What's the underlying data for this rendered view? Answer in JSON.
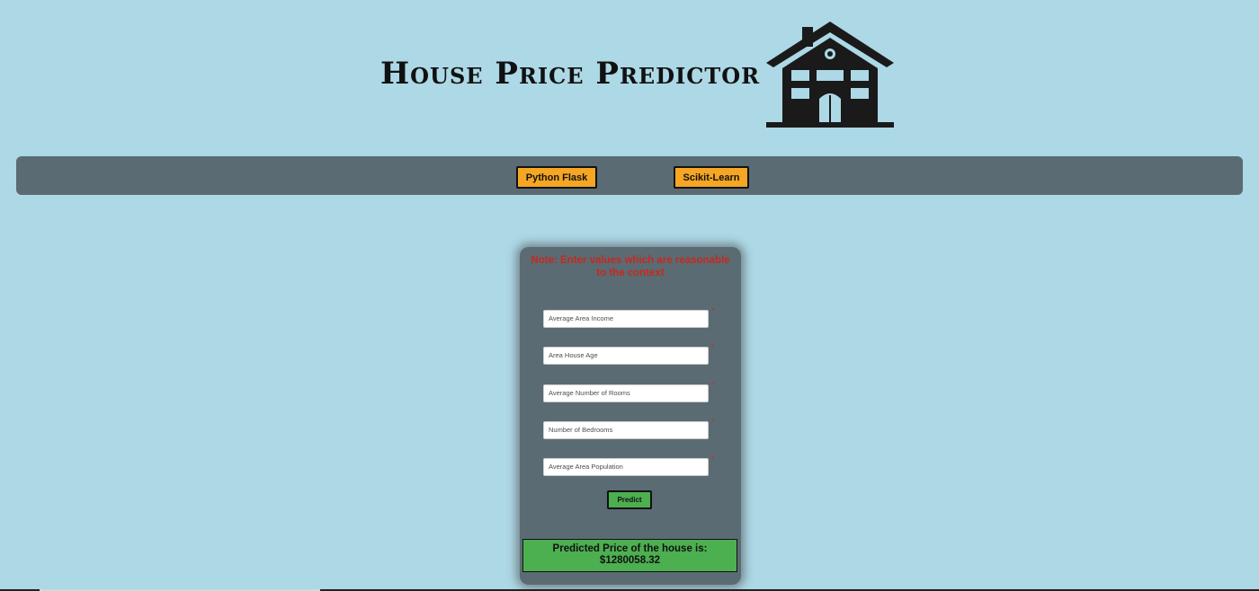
{
  "header": {
    "title": "House Price Predictor",
    "logo_icon": "house-icon"
  },
  "navbar": {
    "buttons": [
      {
        "label": "Python Flask"
      },
      {
        "label": "Scikit-Learn"
      }
    ]
  },
  "form": {
    "note": "Note: Enter values which are reasonable to the context",
    "fields": [
      {
        "placeholder": "Average Area Income",
        "value": "",
        "required_marker": "*"
      },
      {
        "placeholder": "Area House Age",
        "value": "",
        "required_marker": "*"
      },
      {
        "placeholder": "Average Number of Rooms",
        "value": "",
        "required_marker": "*"
      },
      {
        "placeholder": "Number of Bedrooms",
        "value": "",
        "required_marker": "*"
      },
      {
        "placeholder": "Average Area Population",
        "value": "",
        "required_marker": "*"
      }
    ],
    "submit_label": "Predict"
  },
  "result": {
    "label": "Predicted Price of the house is:",
    "value": "$1280058.32"
  },
  "colors": {
    "background": "#add8e6",
    "panel": "#5a6b73",
    "nav_button": "#f5a623",
    "accent_green": "#4caf50",
    "note_red": "#c8281e"
  }
}
